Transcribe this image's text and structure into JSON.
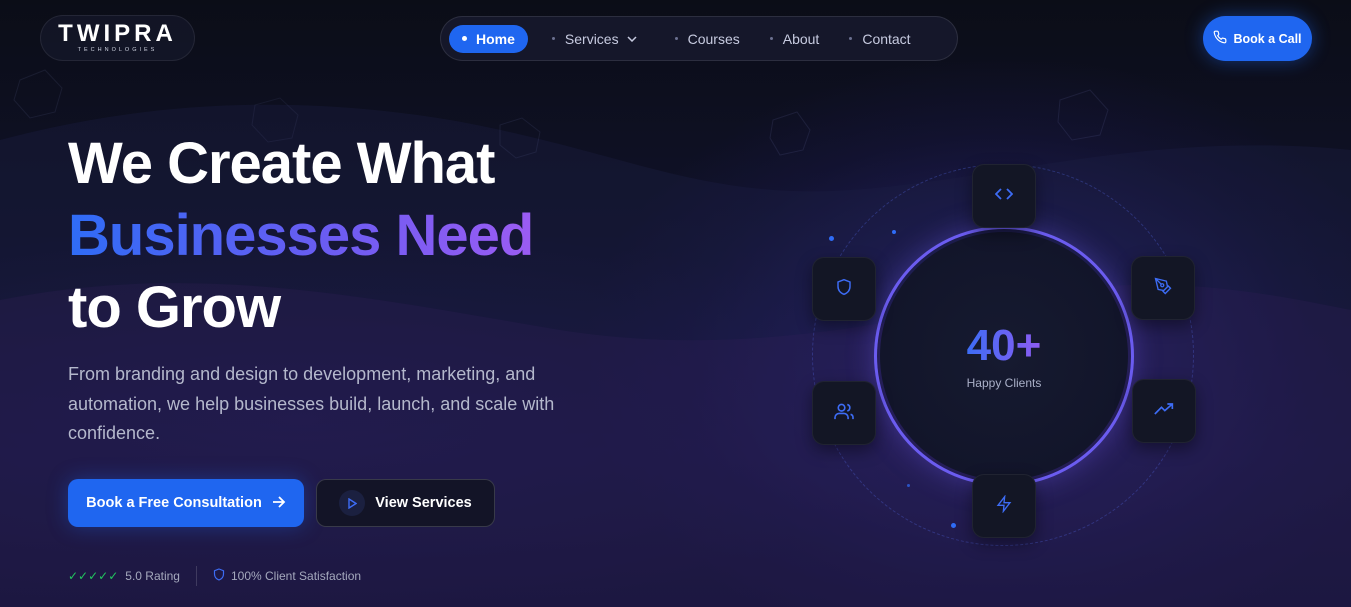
{
  "brand": {
    "name": "TWIPRA",
    "tagline": "TECHNOLOGIES"
  },
  "nav": {
    "items": [
      {
        "label": "Home",
        "active": true
      },
      {
        "label": "Services",
        "has_dropdown": true
      },
      {
        "label": "Courses"
      },
      {
        "label": "About"
      },
      {
        "label": "Contact"
      }
    ]
  },
  "header_cta": {
    "label": "Book a Call",
    "icon": "phone-icon"
  },
  "hero": {
    "headline_line1": "We Create What",
    "headline_line2": "Businesses Need",
    "headline_line3": "to Grow",
    "subtext": "From branding and design to development, marketing, and automation, we help businesses build, launch, and scale with confidence.",
    "primary_button": "Book a Free Consultation",
    "secondary_button": "View Services"
  },
  "trust": {
    "checks": "✓✓✓✓✓",
    "rating": "5.0 Rating",
    "satisfaction": "100% Client Satisfaction"
  },
  "stats": {
    "value": "40+",
    "label": "Happy Clients"
  },
  "orbit_icons": [
    "code-icon",
    "pen-tool-icon",
    "trending-up-icon",
    "zap-icon",
    "users-icon",
    "shield-icon"
  ],
  "colors": {
    "accent": "#1f66f0",
    "gradient_start": "#2f6cf6",
    "gradient_end": "#9b5cf3",
    "background": "#0b0d17",
    "check_green": "#22c55e"
  }
}
